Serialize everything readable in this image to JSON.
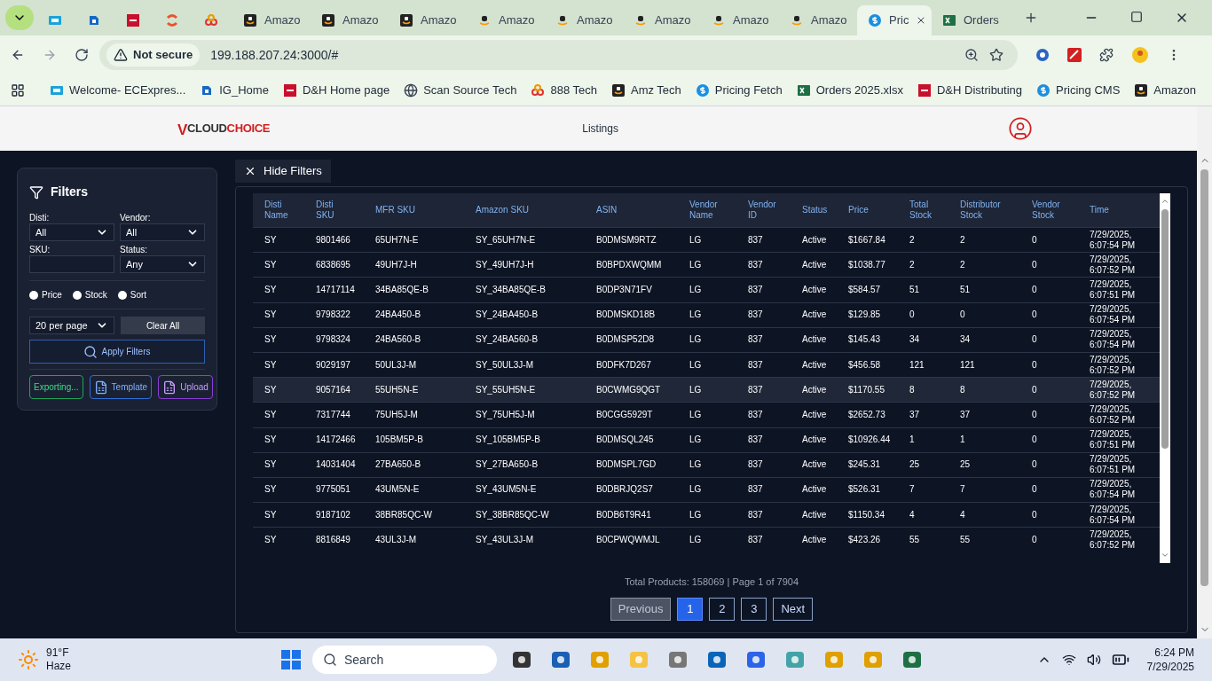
{
  "tabs": [
    {
      "selected": false
    },
    {
      "selected": false
    },
    {
      "selected": false
    },
    {
      "selected": false
    },
    {
      "selected": false
    },
    {
      "label": "Amazo",
      "selected": false
    },
    {
      "label": "Amazo",
      "selected": false
    },
    {
      "label": "Amazo",
      "selected": false
    },
    {
      "label": "Amazo",
      "selected": false
    },
    {
      "label": "Amazo",
      "selected": false
    },
    {
      "label": "Amazo",
      "selected": false
    },
    {
      "label": "Amazo",
      "selected": false
    },
    {
      "label": "Amazo",
      "selected": false
    },
    {
      "label": "Pric",
      "selected": true
    },
    {
      "label": "Orders",
      "selected": false
    }
  ],
  "address": {
    "security": "Not secure",
    "url": "199.188.207.24:3000/#"
  },
  "bookmarks": [
    "Welcome- ECExpres...",
    "IG_Home",
    "D&H Home page",
    "Scan Source Tech",
    "888 Tech",
    "Amz Tech",
    "Pricing Fetch",
    "Orders 2025.xlsx",
    "D&H Distributing",
    "Pricing CMS",
    "Amazon"
  ],
  "header": {
    "logo": {
      "mark": "V",
      "part1": "CLOUD",
      "part2": "CHOICE"
    },
    "nav": "Listings"
  },
  "filters": {
    "title": "Filters",
    "fields": [
      {
        "label": "Disti:",
        "kind": "select",
        "value": "All"
      },
      {
        "label": "Vendor:",
        "kind": "select",
        "value": "All"
      },
      {
        "label": "SKU:",
        "kind": "text"
      },
      {
        "label": "Status:",
        "kind": "select",
        "value": "Any"
      }
    ],
    "radios": [
      {
        "label": "Price",
        "selected": false
      },
      {
        "label": "Stock",
        "selected": false
      },
      {
        "label": "Sort",
        "selected": false
      }
    ],
    "per_page": "20 per page",
    "clear": "Clear All",
    "apply": "Apply Filters",
    "actions": [
      {
        "label": "Exporting...",
        "kind": "export"
      },
      {
        "label": "Template",
        "kind": "template"
      },
      {
        "label": "Upload",
        "kind": "upload"
      }
    ]
  },
  "hide_filters": "Hide Filters",
  "table": {
    "columns": [
      "Disti Name",
      "Disti SKU",
      "MFR SKU",
      "Amazon SKU",
      "ASIN",
      "Vendor Name",
      "Vendor ID",
      "Status",
      "Price",
      "Total Stock",
      "Distributor Stock",
      "Vendor Stock",
      "Time"
    ],
    "rows": [
      {
        "selected": false,
        "cells": [
          "SY",
          "9801466",
          "65UH7N-E",
          "SY_65UH7N-E",
          "B0DMSM9RTZ",
          "LG",
          "837",
          "Active",
          "$1667.84",
          "2",
          "2",
          "0",
          "7/29/2025, 6:07:54 PM"
        ]
      },
      {
        "selected": false,
        "cells": [
          "SY",
          "6838695",
          "49UH7J-H",
          "SY_49UH7J-H",
          "B0BPDXWQMM",
          "LG",
          "837",
          "Active",
          "$1038.77",
          "2",
          "2",
          "0",
          "7/29/2025, 6:07:52 PM"
        ]
      },
      {
        "selected": false,
        "cells": [
          "SY",
          "14717114",
          "34BA85QE-B",
          "SY_34BA85QE-B",
          "B0DP3N71FV",
          "LG",
          "837",
          "Active",
          "$584.57",
          "51",
          "51",
          "0",
          "7/29/2025, 6:07:51 PM"
        ]
      },
      {
        "selected": false,
        "cells": [
          "SY",
          "9798322",
          "24BA450-B",
          "SY_24BA450-B",
          "B0DMSKD18B",
          "LG",
          "837",
          "Active",
          "$129.85",
          "0",
          "0",
          "0",
          "7/29/2025, 6:07:54 PM"
        ]
      },
      {
        "selected": false,
        "cells": [
          "SY",
          "9798324",
          "24BA560-B",
          "SY_24BA560-B",
          "B0DMSP52D8",
          "LG",
          "837",
          "Active",
          "$145.43",
          "34",
          "34",
          "0",
          "7/29/2025, 6:07:54 PM"
        ]
      },
      {
        "selected": false,
        "cells": [
          "SY",
          "9029197",
          "50UL3J-M",
          "SY_50UL3J-M",
          "B0DFK7D267",
          "LG",
          "837",
          "Active",
          "$456.58",
          "121",
          "121",
          "0",
          "7/29/2025, 6:07:52 PM"
        ]
      },
      {
        "selected": true,
        "cells": [
          "SY",
          "9057164",
          "55UH5N-E",
          "SY_55UH5N-E",
          "B0CWMG9QGT",
          "LG",
          "837",
          "Active",
          "$1170.55",
          "8",
          "8",
          "0",
          "7/29/2025, 6:07:52 PM"
        ]
      },
      {
        "selected": false,
        "cells": [
          "SY",
          "7317744",
          "75UH5J-M",
          "SY_75UH5J-M",
          "B0CGG5929T",
          "LG",
          "837",
          "Active",
          "$2652.73",
          "37",
          "37",
          "0",
          "7/29/2025, 6:07:52 PM"
        ]
      },
      {
        "selected": false,
        "cells": [
          "SY",
          "14172466",
          "105BM5P-B",
          "SY_105BM5P-B",
          "B0DMSQL245",
          "LG",
          "837",
          "Active",
          "$10926.44",
          "1",
          "1",
          "0",
          "7/29/2025, 6:07:51 PM"
        ]
      },
      {
        "selected": false,
        "cells": [
          "SY",
          "14031404",
          "27BA650-B",
          "SY_27BA650-B",
          "B0DMSPL7GD",
          "LG",
          "837",
          "Active",
          "$245.31",
          "25",
          "25",
          "0",
          "7/29/2025, 6:07:51 PM"
        ]
      },
      {
        "selected": false,
        "cells": [
          "SY",
          "9775051",
          "43UM5N-E",
          "SY_43UM5N-E",
          "B0DBRJQ2S7",
          "LG",
          "837",
          "Active",
          "$526.31",
          "7",
          "7",
          "0",
          "7/29/2025, 6:07:54 PM"
        ]
      },
      {
        "selected": false,
        "cells": [
          "SY",
          "9187102",
          "38BR85QC-W",
          "SY_38BR85QC-W",
          "B0DB6T9R41",
          "LG",
          "837",
          "Active",
          "$1150.34",
          "4",
          "4",
          "0",
          "7/29/2025, 6:07:54 PM"
        ]
      },
      {
        "selected": false,
        "cells": [
          "SY",
          "8816849",
          "43UL3J-M",
          "SY_43UL3J-M",
          "B0CPWQWMJL",
          "LG",
          "837",
          "Active",
          "$423.26",
          "55",
          "55",
          "0",
          "7/29/2025, 6:07:52 PM"
        ]
      }
    ]
  },
  "summary": "Total Products: 158069 | Page 1 of 7904",
  "pagination": {
    "previous": "Previous",
    "pages": [
      {
        "label": "1",
        "selected": true
      },
      {
        "label": "2",
        "selected": false
      },
      {
        "label": "3",
        "selected": false
      }
    ],
    "next": "Next"
  },
  "taskbar": {
    "temperature": "91°F",
    "weather": "Haze",
    "search": "Search",
    "time": "6:24 PM",
    "date": "7/29/2025"
  }
}
